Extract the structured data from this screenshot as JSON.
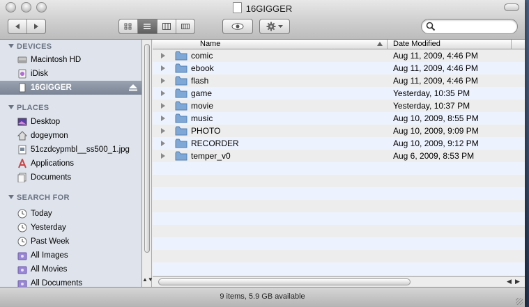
{
  "window": {
    "title": "16GIGGER",
    "status": "9 items, 5.9 GB available"
  },
  "toolbar": {
    "back_label": "◀",
    "forward_label": "▶",
    "views": [
      "icon-view",
      "list-view",
      "column-view",
      "coverflow-view"
    ],
    "active_view": "list-view",
    "search_placeholder": ""
  },
  "sidebar": {
    "sections": [
      {
        "title": "DEVICES",
        "items": [
          {
            "label": "Macintosh HD",
            "icon": "hard-drive-icon"
          },
          {
            "label": "iDisk",
            "icon": "idisk-icon"
          },
          {
            "label": "16GIGGER",
            "icon": "usb-drive-icon",
            "selected": true,
            "eject": true
          }
        ]
      },
      {
        "title": "PLACES",
        "items": [
          {
            "label": "Desktop",
            "icon": "desktop-icon"
          },
          {
            "label": "dogeymon",
            "icon": "home-icon"
          },
          {
            "label": "51czdcypmbl__ss500_1.jpg",
            "icon": "image-file-icon"
          },
          {
            "label": "Applications",
            "icon": "applications-icon"
          },
          {
            "label": "Documents",
            "icon": "documents-icon"
          }
        ]
      },
      {
        "title": "SEARCH FOR",
        "items": [
          {
            "label": "Today",
            "icon": "clock-icon"
          },
          {
            "label": "Yesterday",
            "icon": "clock-icon"
          },
          {
            "label": "Past Week",
            "icon": "clock-icon"
          },
          {
            "label": "All Images",
            "icon": "smart-folder-icon"
          },
          {
            "label": "All Movies",
            "icon": "smart-folder-icon"
          },
          {
            "label": "All Documents",
            "icon": "smart-folder-icon"
          }
        ]
      }
    ]
  },
  "list": {
    "columns": [
      "Name",
      "Date Modified"
    ],
    "rows": [
      {
        "name": "comic",
        "date": "Aug 11, 2009, 4:46 PM"
      },
      {
        "name": "ebook",
        "date": "Aug 11, 2009, 4:46 PM"
      },
      {
        "name": "flash",
        "date": "Aug 11, 2009, 4:46 PM"
      },
      {
        "name": "game",
        "date": "Yesterday, 10:35 PM"
      },
      {
        "name": "movie",
        "date": "Yesterday, 10:37 PM"
      },
      {
        "name": "music",
        "date": "Aug 10, 2009, 8:55 PM"
      },
      {
        "name": "PHOTO",
        "date": "Aug 10, 2009, 9:09 PM"
      },
      {
        "name": "RECORDER",
        "date": "Aug 10, 2009, 9:12 PM"
      },
      {
        "name": "temper_v0",
        "date": "Aug 6, 2009, 8:53 PM"
      }
    ]
  },
  "colors": {
    "sidebar_bg": "#dfe4ec",
    "row_alt": "#edf3fe",
    "folder_blue": "#7fa8d6",
    "section_head": "#6a7283"
  }
}
